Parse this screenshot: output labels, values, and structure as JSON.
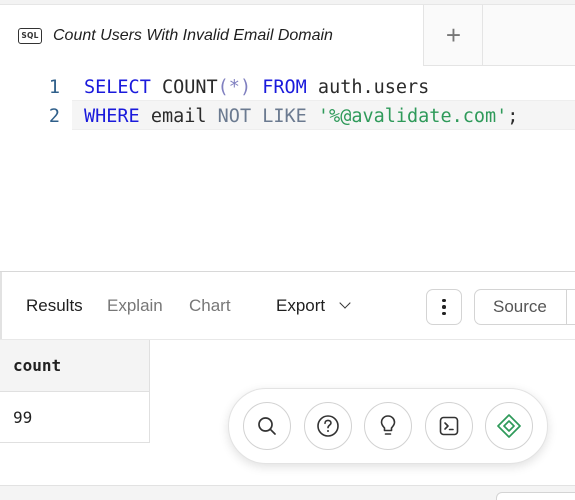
{
  "tab": {
    "icon": "sql-file-icon",
    "icon_text": "SQL",
    "title": "Count Users With Invalid Email Domain",
    "add_label": "+"
  },
  "editor": {
    "lines": [
      {
        "number": "1",
        "tokens": [
          {
            "t": "SELECT",
            "k": "kw"
          },
          {
            "t": " ",
            "k": "id"
          },
          {
            "t": "COUNT",
            "k": "fn"
          },
          {
            "t": "(*)",
            "k": "op"
          },
          {
            "t": " ",
            "k": "id"
          },
          {
            "t": "FROM",
            "k": "kw"
          },
          {
            "t": " auth.users",
            "k": "id"
          }
        ]
      },
      {
        "number": "2",
        "tokens": [
          {
            "t": "WHERE",
            "k": "kw"
          },
          {
            "t": " email ",
            "k": "id"
          },
          {
            "t": "NOT LIKE",
            "k": "kw2"
          },
          {
            "t": " ",
            "k": "id"
          },
          {
            "t": "'%@avalidate.com'",
            "k": "str"
          },
          {
            "t": ";",
            "k": "id"
          }
        ]
      }
    ]
  },
  "results_toolbar": {
    "tabs": [
      "Results",
      "Explain",
      "Chart"
    ],
    "active_tab": "Results",
    "export_label": "Export",
    "more_icon": "vertical-ellipsis-icon",
    "source_label": "Source"
  },
  "results": {
    "columns": [
      "count"
    ],
    "rows": [
      [
        "99"
      ]
    ]
  },
  "action_bar": {
    "buttons": [
      {
        "name": "search-icon"
      },
      {
        "name": "help-icon"
      },
      {
        "name": "lightbulb-icon"
      },
      {
        "name": "terminal-icon"
      },
      {
        "name": "diamond-target-icon"
      }
    ]
  },
  "colors": {
    "keyword": "#1a1adc",
    "string": "#2f9a5a",
    "line_number": "#2f5f8a"
  }
}
